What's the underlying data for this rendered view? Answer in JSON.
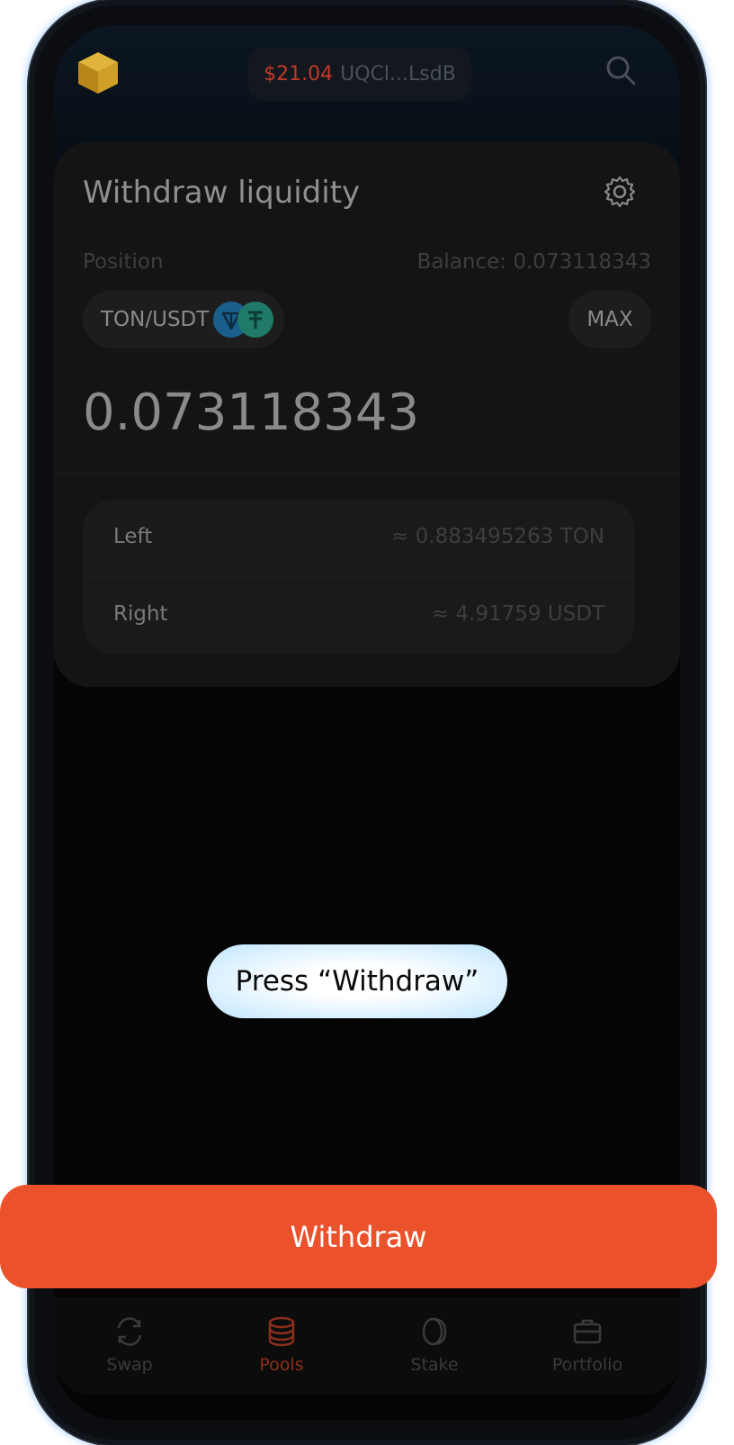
{
  "header": {
    "wallet_balance": "$21.04",
    "wallet_address": "UQCl...LsdB",
    "accent_color": "#c0392b"
  },
  "card": {
    "title": "Withdraw liquidity",
    "position_label": "Position",
    "balance_text": "Balance: 0.073118343",
    "pair": "TON/USDT",
    "max_label": "MAX",
    "amount": "0.073118343",
    "rows": [
      {
        "label": "Left",
        "value": "≈ 0.883495263 TON"
      },
      {
        "label": "Right",
        "value": "≈ 4.91759 USDT"
      }
    ]
  },
  "tooltip": "Press “Withdraw”",
  "primary_button": {
    "label": "Withdraw",
    "color": "#eb522b"
  },
  "nav": {
    "items": [
      {
        "label": "Swap",
        "icon": "swap-icon"
      },
      {
        "label": "Pools",
        "icon": "pools-icon",
        "active": true
      },
      {
        "label": "Stake",
        "icon": "stake-icon"
      },
      {
        "label": "Portfolio",
        "icon": "portfolio-icon"
      }
    ]
  }
}
